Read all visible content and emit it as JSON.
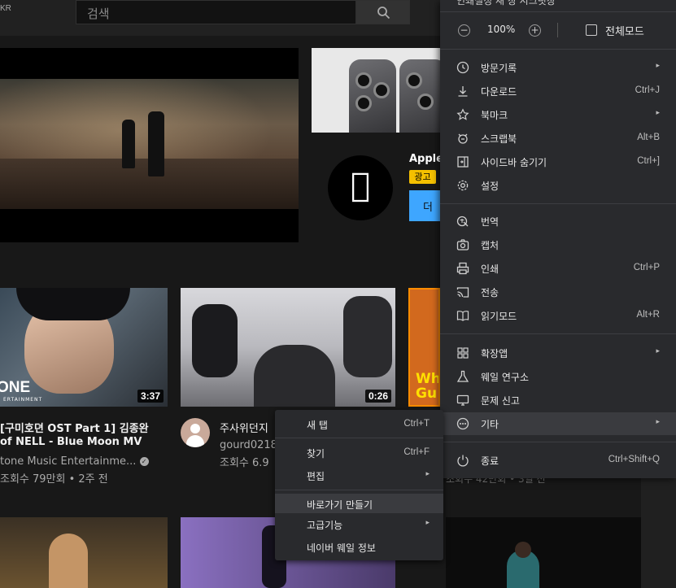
{
  "youtube": {
    "region": "KR",
    "search_placeholder": "검색",
    "ad": {
      "title": "Apple",
      "badge": "광고",
      "button": "더"
    },
    "videos": [
      {
        "title_line1": "[구미호뎐 OST Part 1] 김종완",
        "title_line2": "of NELL - Blue Moon MV",
        "channel": "tone Music Entertainme...",
        "stats": "조회수 79만회 • 2주 전",
        "duration": "3:37",
        "thumb_text": "ONE",
        "thumb_sub": "ERTAINMENT"
      },
      {
        "title_line1": "주사위던지",
        "channel": "gourd0218",
        "stats": "조회수 6.9",
        "duration": "0:26"
      },
      {
        "thumb_text_1": "Wh",
        "thumb_text_2": "Gu"
      }
    ],
    "partial_stats": "조회수 42만회 • 3일 전"
  },
  "menu": {
    "top_cut": "인쇄설정         새 창         시크릿창",
    "zoom": {
      "minus": "−",
      "value": "100%",
      "plus": "+",
      "fullscreen_label": "전체모드"
    },
    "items": [
      {
        "label": "방문기록",
        "shortcut": "",
        "arrow": "▸",
        "icon": "history-icon"
      },
      {
        "label": "다운로드",
        "shortcut": "Ctrl+J",
        "arrow": "",
        "icon": "download-icon"
      },
      {
        "label": "북마크",
        "shortcut": "",
        "arrow": "▸",
        "icon": "star-icon"
      },
      {
        "label": "스크랩북",
        "shortcut": "Alt+B",
        "arrow": "",
        "icon": "scrapbook-icon"
      },
      {
        "label": "사이드바 숨기기",
        "shortcut": "Ctrl+]",
        "arrow": "",
        "icon": "sidebar-icon"
      },
      {
        "label": "설정",
        "shortcut": "",
        "arrow": "",
        "icon": "gear-icon"
      },
      {
        "label": "번역",
        "shortcut": "",
        "arrow": "",
        "icon": "translate-icon"
      },
      {
        "label": "캡처",
        "shortcut": "",
        "arrow": "",
        "icon": "camera-icon"
      },
      {
        "label": "인쇄",
        "shortcut": "Ctrl+P",
        "arrow": "",
        "icon": "print-icon"
      },
      {
        "label": "전송",
        "shortcut": "",
        "arrow": "",
        "icon": "cast-icon"
      },
      {
        "label": "읽기모드",
        "shortcut": "Alt+R",
        "arrow": "",
        "icon": "book-icon"
      },
      {
        "label": "확장앱",
        "shortcut": "",
        "arrow": "▸",
        "icon": "extensions-icon"
      },
      {
        "label": "웨일 연구소",
        "shortcut": "",
        "arrow": "",
        "icon": "flask-icon"
      },
      {
        "label": "문제 신고",
        "shortcut": "",
        "arrow": "",
        "icon": "report-icon"
      },
      {
        "label": "기타",
        "shortcut": "",
        "arrow": "▸",
        "icon": "more-icon"
      },
      {
        "label": "종료",
        "shortcut": "Ctrl+Shift+Q",
        "arrow": "",
        "icon": "power-icon"
      }
    ]
  },
  "submenu": {
    "items": [
      {
        "label": "새 탭",
        "shortcut": "Ctrl+T",
        "arrow": ""
      },
      {
        "label": "찾기",
        "shortcut": "Ctrl+F",
        "arrow": ""
      },
      {
        "label": "편집",
        "shortcut": "",
        "arrow": "▸"
      },
      {
        "label": "바로가기 만들기",
        "shortcut": "",
        "arrow": ""
      },
      {
        "label": "고급기능",
        "shortcut": "",
        "arrow": "▸"
      },
      {
        "label": "네이버 웨일 정보",
        "shortcut": "",
        "arrow": ""
      }
    ]
  }
}
